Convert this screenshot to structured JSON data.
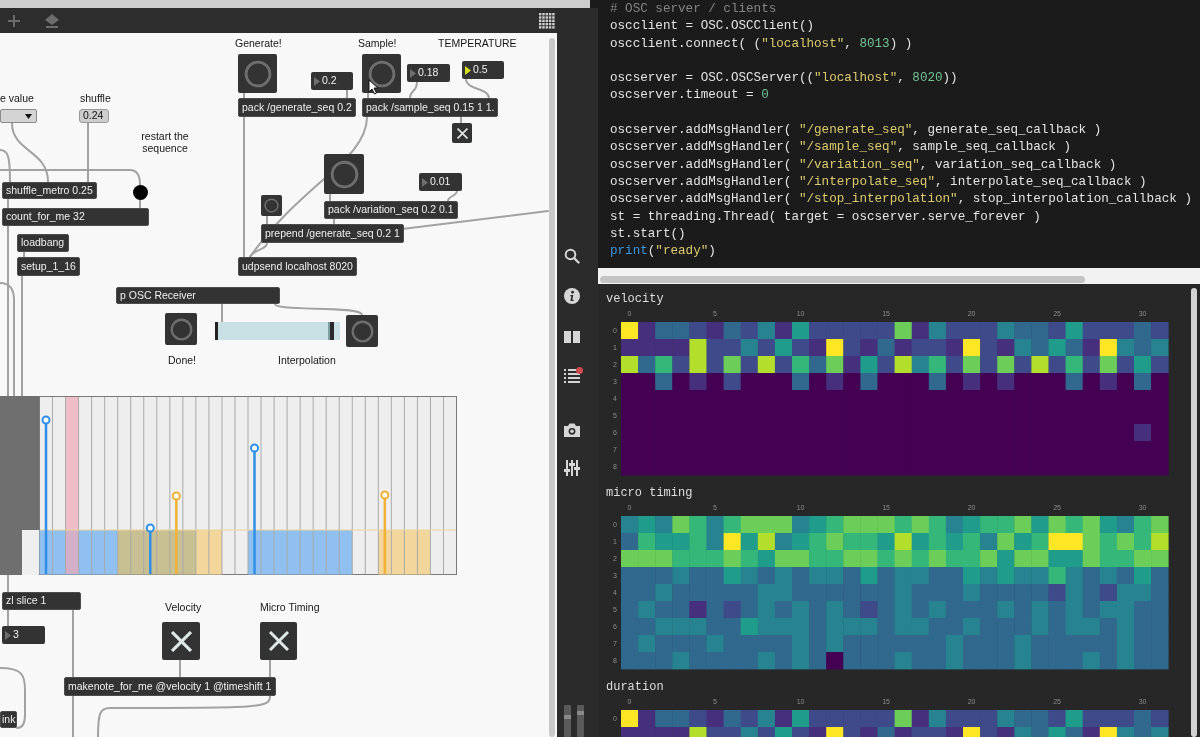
{
  "patcher": {
    "objects": [
      {
        "kind": "comment",
        "text": "Generate!"
      },
      {
        "kind": "comment",
        "text": "Sample!"
      },
      {
        "kind": "comment",
        "text": "TEMPERATURE"
      },
      {
        "kind": "button"
      },
      {
        "kind": "number",
        "text": "0.2",
        "color": "#6e6e6e"
      },
      {
        "kind": "button"
      },
      {
        "kind": "number",
        "text": "0.18",
        "color": "#6e6e6e"
      },
      {
        "kind": "number",
        "text": "0.5",
        "color": "#d8e021"
      },
      {
        "kind": "comment",
        "text": "e value"
      },
      {
        "kind": "comment",
        "text": "shuffle"
      },
      {
        "kind": "menu"
      },
      {
        "kind": "message",
        "text": "0.24"
      },
      {
        "kind": "object",
        "text": "pack /generate_seq 0.2"
      },
      {
        "kind": "object",
        "text": "pack /sample_seq 0.15 1 1."
      },
      {
        "kind": "comment",
        "text": "restart the sequence"
      },
      {
        "kind": "toggle",
        "checked": true
      },
      {
        "kind": "button"
      },
      {
        "kind": "number",
        "text": "0.01",
        "color": "#6e6e6e"
      },
      {
        "kind": "object",
        "text": "shuffle_metro 0.25"
      },
      {
        "kind": "dot"
      },
      {
        "kind": "button"
      },
      {
        "kind": "object",
        "text": "pack /variation_seq 0.2 0.1"
      },
      {
        "kind": "object",
        "text": "count_for_me 32"
      },
      {
        "kind": "object",
        "text": "prepend /generate_seq 0.2 1"
      },
      {
        "kind": "object",
        "text": "loadbang"
      },
      {
        "kind": "object",
        "text": "setup_1_16"
      },
      {
        "kind": "object",
        "text": "udpsend localhost 8020"
      },
      {
        "kind": "object",
        "text": "p OSC Receiver"
      },
      {
        "kind": "button"
      },
      {
        "kind": "slider",
        "level": 0.95
      },
      {
        "kind": "button"
      },
      {
        "kind": "comment",
        "text": "Done!"
      },
      {
        "kind": "comment",
        "text": "Interpolation"
      },
      {
        "kind": "object",
        "text": "zl slice 1"
      },
      {
        "kind": "comment",
        "text": "Velocity"
      },
      {
        "kind": "comment",
        "text": "Micro Timing"
      },
      {
        "kind": "toggle",
        "checked": true
      },
      {
        "kind": "toggle",
        "checked": true
      },
      {
        "kind": "number",
        "text": "3",
        "color": "#6e6e6e"
      },
      {
        "kind": "object",
        "text": "makenote_for_me @velocity 1 @timeshift 1"
      },
      {
        "kind": "object",
        "text": "ink"
      }
    ]
  },
  "notebook": {
    "code_cell": {
      "blocks": [
        {
          "lines": [
            {
              "tokens": [
                {
                  "kind": "comment",
                  "text": "# OSC server / clients"
                }
              ]
            },
            {
              "tokens": [
                {
                  "kind": "plain",
                  "text": "oscclient = OSC.OSCClient()"
                }
              ]
            },
            {
              "tokens": [
                {
                  "kind": "plain",
                  "text": "oscclient.connect( ("
                },
                {
                  "kind": "string",
                  "text": "\"localhost\""
                },
                {
                  "kind": "plain",
                  "text": ", "
                },
                {
                  "kind": "number",
                  "text": "8013"
                },
                {
                  "kind": "plain",
                  "text": ") )"
                }
              ]
            }
          ]
        },
        {
          "lines": [
            {
              "tokens": [
                {
                  "kind": "plain",
                  "text": "oscserver = OSC.OSCServer(("
                },
                {
                  "kind": "string",
                  "text": "\"localhost\""
                },
                {
                  "kind": "plain",
                  "text": ", "
                },
                {
                  "kind": "number",
                  "text": "8020"
                },
                {
                  "kind": "plain",
                  "text": "))"
                }
              ]
            },
            {
              "tokens": [
                {
                  "kind": "plain",
                  "text": "oscserver.timeout = "
                },
                {
                  "kind": "number",
                  "text": "0"
                }
              ]
            }
          ]
        },
        {
          "lines": [
            {
              "tokens": [
                {
                  "kind": "plain",
                  "text": "oscserver.addMsgHandler( "
                },
                {
                  "kind": "string",
                  "text": "\"/generate_seq\""
                },
                {
                  "kind": "plain",
                  "text": ", generate_seq_callback )"
                }
              ]
            },
            {
              "tokens": [
                {
                  "kind": "plain",
                  "text": "oscserver.addMsgHandler( "
                },
                {
                  "kind": "string",
                  "text": "\"/sample_seq\""
                },
                {
                  "kind": "plain",
                  "text": ", sample_seq_callback )"
                }
              ]
            },
            {
              "tokens": [
                {
                  "kind": "plain",
                  "text": "oscserver.addMsgHandler( "
                },
                {
                  "kind": "string",
                  "text": "\"/variation_seq\""
                },
                {
                  "kind": "plain",
                  "text": ", variation_seq_callback )"
                }
              ]
            },
            {
              "tokens": [
                {
                  "kind": "plain",
                  "text": "oscserver.addMsgHandler( "
                },
                {
                  "kind": "string",
                  "text": "\"/interpolate_seq\""
                },
                {
                  "kind": "plain",
                  "text": ", interpolate_seq_callback )"
                }
              ]
            },
            {
              "tokens": [
                {
                  "kind": "plain",
                  "text": "oscserver.addMsgHandler( "
                },
                {
                  "kind": "string",
                  "text": "\"/stop_interpolation\""
                },
                {
                  "kind": "plain",
                  "text": ", stop_interpolation_callback )"
                }
              ]
            },
            {
              "tokens": [
                {
                  "kind": "plain",
                  "text": "st = threading.Thread( target = oscserver.serve_forever )"
                }
              ]
            },
            {
              "tokens": [
                {
                  "kind": "plain",
                  "text": "st.start()"
                }
              ]
            },
            {
              "tokens": [
                {
                  "kind": "keyword",
                  "text": "print"
                },
                {
                  "kind": "plain",
                  "text": "("
                },
                {
                  "kind": "string",
                  "text": "\"ready\""
                },
                {
                  "kind": "plain",
                  "text": ")"
                }
              ]
            }
          ]
        }
      ]
    },
    "outputs": [
      {
        "title": "velocity",
        "xticks": [
          "0",
          "5",
          "10",
          "15",
          "20",
          "25",
          "30"
        ],
        "yticks": [
          "0",
          "1",
          "2",
          "3",
          "4",
          "5",
          "6",
          "7",
          "8"
        ]
      },
      {
        "title": "micro timing",
        "xticks": [
          "0",
          "5",
          "10",
          "15",
          "20",
          "25",
          "30"
        ],
        "yticks": [
          "0",
          "1",
          "2",
          "3",
          "4",
          "5",
          "6",
          "7",
          "8"
        ]
      },
      {
        "title": "duration",
        "xticks": [
          "0",
          "5",
          "10",
          "15",
          "20",
          "25",
          "30"
        ],
        "yticks": [
          "0"
        ]
      }
    ]
  }
}
